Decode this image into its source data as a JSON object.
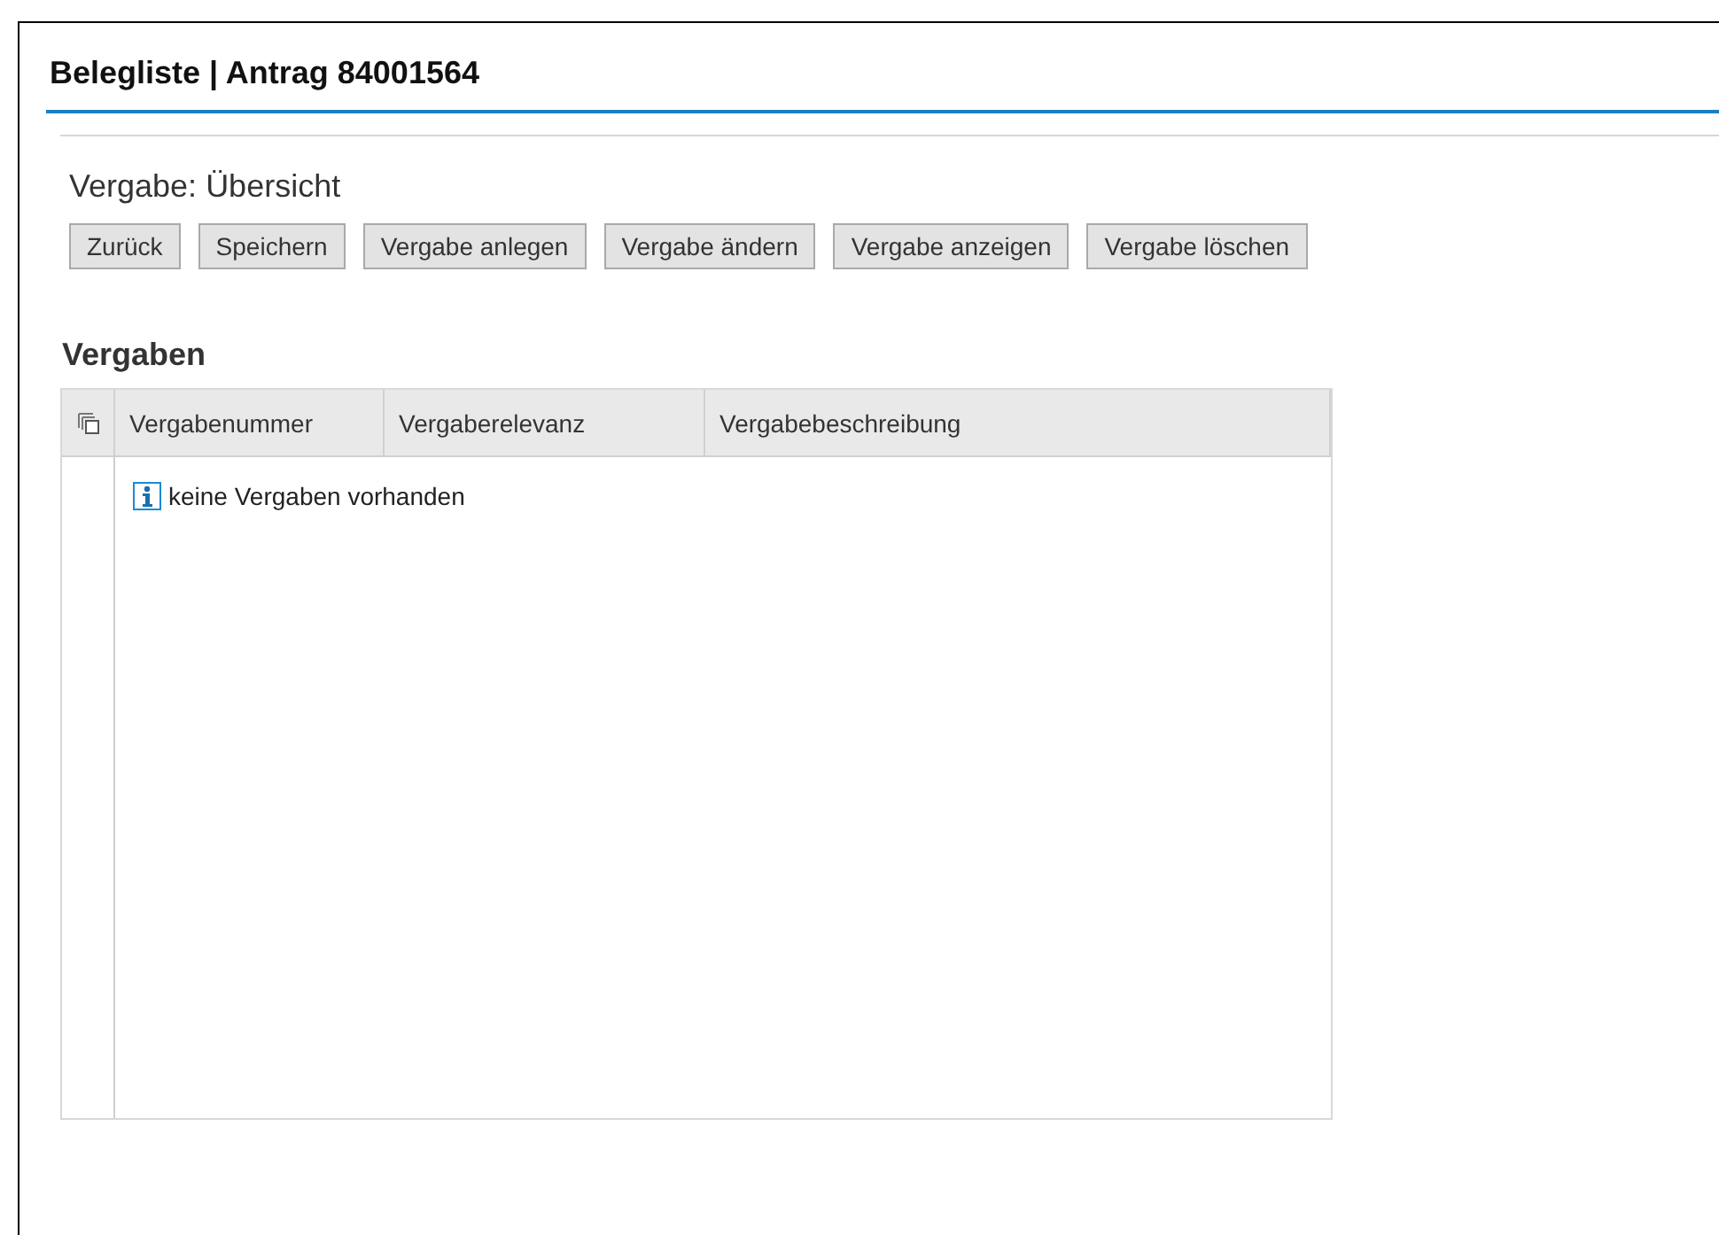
{
  "window": {
    "title": "Belegliste | Antrag 84001564"
  },
  "section": {
    "title": "Vergabe: Übersicht"
  },
  "buttons": [
    "Zurück",
    "Speichern",
    "Vergabe anlegen",
    "Vergabe ändern",
    "Vergabe anzeigen",
    "Vergabe löschen"
  ],
  "table": {
    "title": "Vergaben",
    "columns": [
      "Vergabenummer",
      "Vergaberelevanz",
      "Vergabebeschreibung"
    ],
    "empty_message": "keine Vergaben vorhanden"
  }
}
